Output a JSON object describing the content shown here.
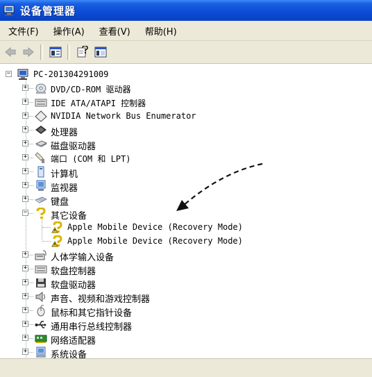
{
  "window": {
    "title": "设备管理器"
  },
  "menu": {
    "file": "文件(F)",
    "action": "操作(A)",
    "view": "查看(V)",
    "help": "帮助(H)"
  },
  "tree": {
    "root": "PC-201304291009",
    "items": [
      "DVD/CD-ROM 驱动器",
      "IDE ATA/ATAPI 控制器",
      "NVIDIA Network Bus Enumerator",
      "处理器",
      "磁盘驱动器",
      "端口 (COM 和 LPT)",
      "计算机",
      "监视器",
      "键盘",
      "其它设备",
      "Apple Mobile Device (Recovery Mode)",
      "Apple Mobile Device (Recovery Mode)",
      "人体学输入设备",
      "软盘控制器",
      "软盘驱动器",
      "声音、视频和游戏控制器",
      "鼠标和其它指针设备",
      "通用串行总线控制器",
      "网络适配器",
      "系统设备"
    ]
  },
  "colors": {
    "title_bar": "#0b4bd6",
    "chrome": "#ece9d8",
    "warning": "#f5d000"
  }
}
